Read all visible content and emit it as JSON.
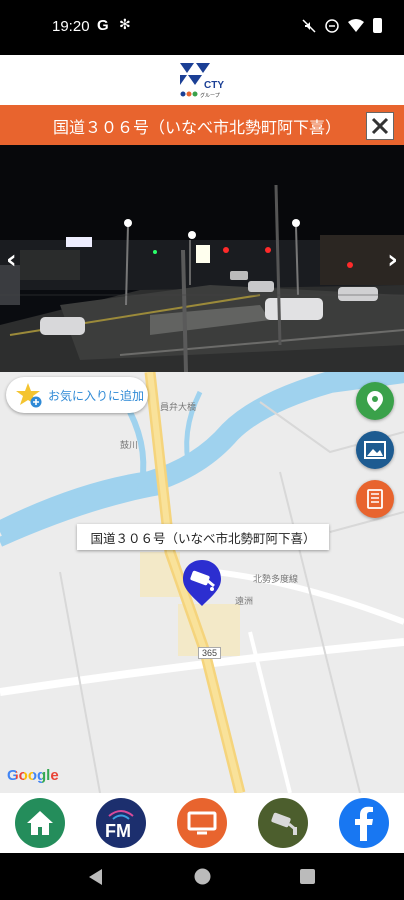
{
  "status_bar": {
    "time": "19:20",
    "g_label": "G"
  },
  "header": {
    "logo_text": "CTY",
    "logo_subtext": "グループ",
    "title": "国道３０６号（いなべ市北勢町阿下喜）"
  },
  "map": {
    "favorite_label": "お気に入りに追加",
    "popup_label": "国道３０６号（いなべ市北勢町阿下喜）",
    "google_label": "Google",
    "road_labels": [
      "員弁大橋",
      "鼓川",
      "北勢多度線",
      "遠洲"
    ],
    "route_badge": "365"
  },
  "colors": {
    "accent": "#e8642e",
    "map_green": "#3aa14a",
    "map_navy": "#1d5b91",
    "home_green": "#248d5b",
    "fm_navy": "#1c2f6e",
    "tv_orange": "#e8642e",
    "cam_olive": "#4c5e2d",
    "facebook_blue": "#1877f2"
  },
  "bottom_nav": [
    "home-icon",
    "fm-icon",
    "tv-icon",
    "camera-icon",
    "facebook-icon"
  ],
  "bottom_nav_fm_label": "FM"
}
